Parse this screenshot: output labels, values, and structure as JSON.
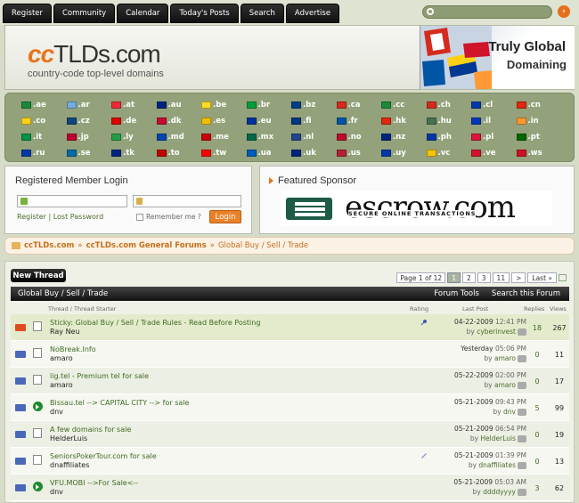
{
  "nav": {
    "tabs": [
      "Register",
      "Community",
      "Calendar",
      "Today's Posts",
      "Search",
      "Advertise"
    ]
  },
  "header": {
    "logo_cc": "cc",
    "logo_rest": "TLDs.com",
    "tagline": "country-code top-level domains",
    "banner_line1": "Truly Global",
    "banner_line2": "Domaining"
  },
  "flags": [
    {
      "tld": ".ae",
      "color": "#1a8a3a"
    },
    {
      "tld": ".ar",
      "color": "#74acdf"
    },
    {
      "tld": ".at",
      "color": "#ed2939"
    },
    {
      "tld": ".au",
      "color": "#00247d"
    },
    {
      "tld": ".be",
      "color": "#fdda24"
    },
    {
      "tld": ".br",
      "color": "#009c3b"
    },
    {
      "tld": ".bz",
      "color": "#003f87"
    },
    {
      "tld": ".ca",
      "color": "#d52b1e"
    },
    {
      "tld": ".cc",
      "color": "#1a8a3a"
    },
    {
      "tld": ".ch",
      "color": "#d52b1e"
    },
    {
      "tld": ".cl",
      "color": "#0039a6"
    },
    {
      "tld": ".cn",
      "color": "#de2910"
    },
    {
      "tld": ".co",
      "color": "#fcd116"
    },
    {
      "tld": ".cz",
      "color": "#11457e"
    },
    {
      "tld": ".de",
      "color": "#dd0000"
    },
    {
      "tld": ".dk",
      "color": "#c60c30"
    },
    {
      "tld": ".es",
      "color": "#f1bf00"
    },
    {
      "tld": ".eu",
      "color": "#003399"
    },
    {
      "tld": ".fi",
      "color": "#003580"
    },
    {
      "tld": ".fr",
      "color": "#0055a4"
    },
    {
      "tld": ".hk",
      "color": "#de2910"
    },
    {
      "tld": ".hu",
      "color": "#477050"
    },
    {
      "tld": ".il",
      "color": "#0038b8"
    },
    {
      "tld": ".in",
      "color": "#ff9933"
    },
    {
      "tld": ".it",
      "color": "#009246"
    },
    {
      "tld": ".jp",
      "color": "#bc002d"
    },
    {
      "tld": ".ly",
      "color": "#239e46"
    },
    {
      "tld": ".md",
      "color": "#0046ae"
    },
    {
      "tld": ".me",
      "color": "#c40308"
    },
    {
      "tld": ".mx",
      "color": "#006847"
    },
    {
      "tld": ".nl",
      "color": "#21468b"
    },
    {
      "tld": ".no",
      "color": "#ba0c2f"
    },
    {
      "tld": ".nz",
      "color": "#00247d"
    },
    {
      "tld": ".ph",
      "color": "#0038a8"
    },
    {
      "tld": ".pl",
      "color": "#dc143c"
    },
    {
      "tld": ".pt",
      "color": "#006600"
    },
    {
      "tld": ".ru",
      "color": "#0039a6"
    },
    {
      "tld": ".se",
      "color": "#006aa7"
    },
    {
      "tld": ".tk",
      "color": "#00247d"
    },
    {
      "tld": ".to",
      "color": "#c10000"
    },
    {
      "tld": ".tw",
      "color": "#fe0000"
    },
    {
      "tld": ".ua",
      "color": "#005bbb"
    },
    {
      "tld": ".uk",
      "color": "#00247d"
    },
    {
      "tld": ".us",
      "color": "#b22234"
    },
    {
      "tld": ".uy",
      "color": "#0038a8"
    },
    {
      "tld": ".vc",
      "color": "#f4c400"
    },
    {
      "tld": ".ve",
      "color": "#cf142b"
    },
    {
      "tld": ".ws",
      "color": "#ce1126"
    }
  ],
  "login": {
    "title": "Registered Member Login",
    "register_link": "Register",
    "sep": " | ",
    "lost_password_link": "Lost Password",
    "remember_label": "Remember me ?",
    "login_button": "Login"
  },
  "sponsor": {
    "title": "Featured Sponsor",
    "word": "escrow.com",
    "sub": "SECURE ONLINE TRANSACTIONS"
  },
  "breadcrumb": {
    "site": "ccTLDs.com",
    "sep1": "»",
    "forums": "ccTLDs.com General Forums",
    "sep2": "»",
    "current": "Global Buy / Sell / Trade"
  },
  "forum": {
    "new_thread": "New Thread",
    "page_label": "Page 1 of 12",
    "pages": [
      "1",
      "2",
      "3",
      "11",
      ">",
      "Last »"
    ],
    "title": "Global Buy / Sell / Trade",
    "tools": [
      "Forum Tools",
      "Search this Forum"
    ],
    "columns": {
      "thread": "Thread / Thread Starter",
      "rating": "Rating",
      "last_post": "Last Post",
      "replies": "Replies",
      "views": "Views"
    },
    "threads": [
      {
        "status": "hot",
        "icon": "doc",
        "title": "Sticky: Global Buy / Sell / Trade Rules - Read Before Posting",
        "starter": "Ray Neu",
        "date": "04-22-2009",
        "time": "12:41 PM",
        "by": "cyberinvest",
        "replies": "18",
        "views": "267",
        "mark": "pin"
      },
      {
        "status": "new",
        "icon": "doc",
        "title": "NoBreak.Info",
        "starter": "amaro",
        "date": "Yesterday",
        "time": "05:06 PM",
        "by": "amaro",
        "replies": "0",
        "views": "11",
        "mark": ""
      },
      {
        "status": "new",
        "icon": "doc",
        "title": "lig.tel - Premium tel for sale",
        "starter": "amaro",
        "date": "05-22-2009",
        "time": "02:00 PM",
        "by": "amaro",
        "replies": "0",
        "views": "17",
        "mark": ""
      },
      {
        "status": "new",
        "icon": "arrow",
        "title": "Bissau.tel --> CAPITAL CITY --> for sale",
        "starter": "dnv",
        "date": "05-21-2009",
        "time": "09:43 PM",
        "by": "dnv",
        "replies": "5",
        "views": "99",
        "mark": ""
      },
      {
        "status": "new",
        "icon": "doc",
        "title": "A few domains for sale",
        "starter": "HelderLuis",
        "date": "05-21-2009",
        "time": "06:54 PM",
        "by": "HelderLuis",
        "replies": "0",
        "views": "19",
        "mark": ""
      },
      {
        "status": "new",
        "icon": "doc",
        "title": "SeniorsPokerTour.com for sale",
        "starter": "dnaffiliates",
        "date": "05-21-2009",
        "time": "01:39 PM",
        "by": "dnaffiliates",
        "replies": "0",
        "views": "13",
        "mark": "clip"
      },
      {
        "status": "new",
        "icon": "arrow",
        "title": "VFU.MOBI -->For Sale<--",
        "starter": "dnv",
        "date": "05-21-2009",
        "time": "05:03 AM",
        "by": "ddddyyyy",
        "replies": "3",
        "views": "62",
        "mark": ""
      }
    ]
  }
}
